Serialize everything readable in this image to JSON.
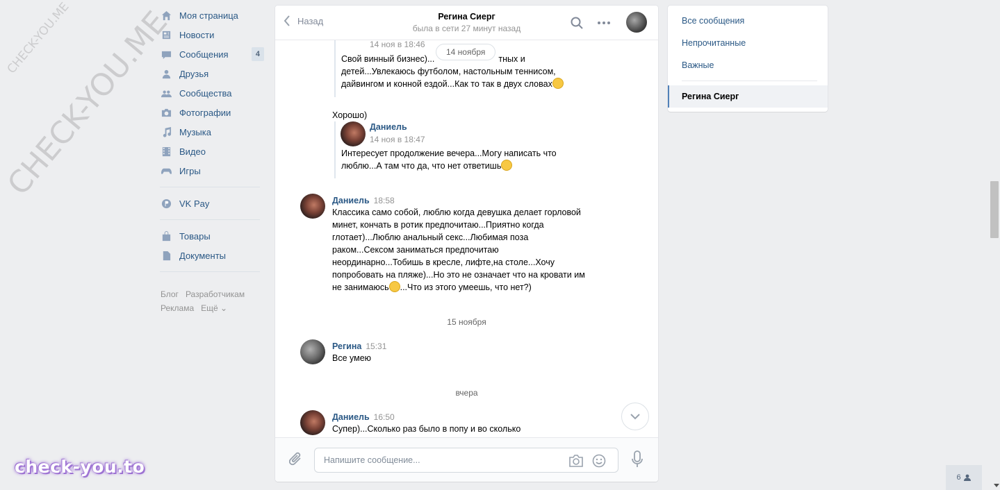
{
  "watermarks": {
    "small": "CHECK-YOU.ME",
    "large": "CHECK-YOU.ME",
    "bottom": "check-you.to"
  },
  "leftnav": {
    "items": [
      {
        "label": "Моя страница",
        "icon": "home-icon"
      },
      {
        "label": "Новости",
        "icon": "news-icon"
      },
      {
        "label": "Сообщения",
        "icon": "messages-icon",
        "badge": "4"
      },
      {
        "label": "Друзья",
        "icon": "friends-icon"
      },
      {
        "label": "Сообщества",
        "icon": "groups-icon"
      },
      {
        "label": "Фотографии",
        "icon": "camera-icon"
      },
      {
        "label": "Музыка",
        "icon": "music-icon"
      },
      {
        "label": "Видео",
        "icon": "video-icon"
      },
      {
        "label": "Игры",
        "icon": "gamepad-icon"
      }
    ],
    "vkpay": {
      "label": "VK Pay",
      "icon": "vkpay-icon"
    },
    "extra": [
      {
        "label": "Товары",
        "icon": "bag-icon"
      },
      {
        "label": "Документы",
        "icon": "document-icon"
      }
    ],
    "footer": {
      "blog": "Блог",
      "dev": "Разработчикам",
      "ads": "Реклама",
      "more": "Ещё ⌄"
    }
  },
  "chat": {
    "back_label": "Назад",
    "title": "Регина Сиерг",
    "status": "была в сети 27 минут назад",
    "floating_date": "14 ноября",
    "fwd1": {
      "time": "14 ноя в 18:46",
      "text_l1": "Свой винный бизнес)...",
      "text_l1b": "тных и",
      "text_l2": "детей...Увлекаюсь футболом, настольным теннисом,",
      "text_l3": "дайвингом и конной ездой...Как то так в двух словах"
    },
    "reply1": "Хорошо)",
    "fwd2": {
      "author": "Даниель",
      "time": "14 ноя в 18:47",
      "text_l1": "Интересует продолжение вечера...Могу написать что",
      "text_l2": "люблю...А там что да, что нет ответишь"
    },
    "msg1": {
      "author": "Даниель",
      "time": "18:58",
      "lines": [
        "Классика само собой, люблю когда девушка делает горловой",
        "минет, кончать в ротик предпочитаю...Приятно когда",
        "глотает)...Люблю анальный секс...Любимая поза",
        "раком...Сексом заниматься предпочитаю",
        "неординарно...Тобишь в кресле, лифте,на столе...Хочу",
        "попробовать на пляже)...Но это не означает что на кровати им",
        "не занимаюсь",
        "...Что из этого умеешь, что нет?)"
      ]
    },
    "date2": "15 ноября",
    "msg2": {
      "author": "Регина",
      "time": "15:31",
      "text": "Все умею"
    },
    "date3": "вчера",
    "msg3": {
      "author": "Даниель",
      "time": "16:50",
      "text": "Супер)...Сколько раз было в попу и во сколько"
    },
    "compose_placeholder": "Напишите сообщение..."
  },
  "right": {
    "all": "Все сообщения",
    "unread": "Непрочитанные",
    "important": "Важные",
    "active": "Регина Сиерг"
  },
  "online_count": "6"
}
